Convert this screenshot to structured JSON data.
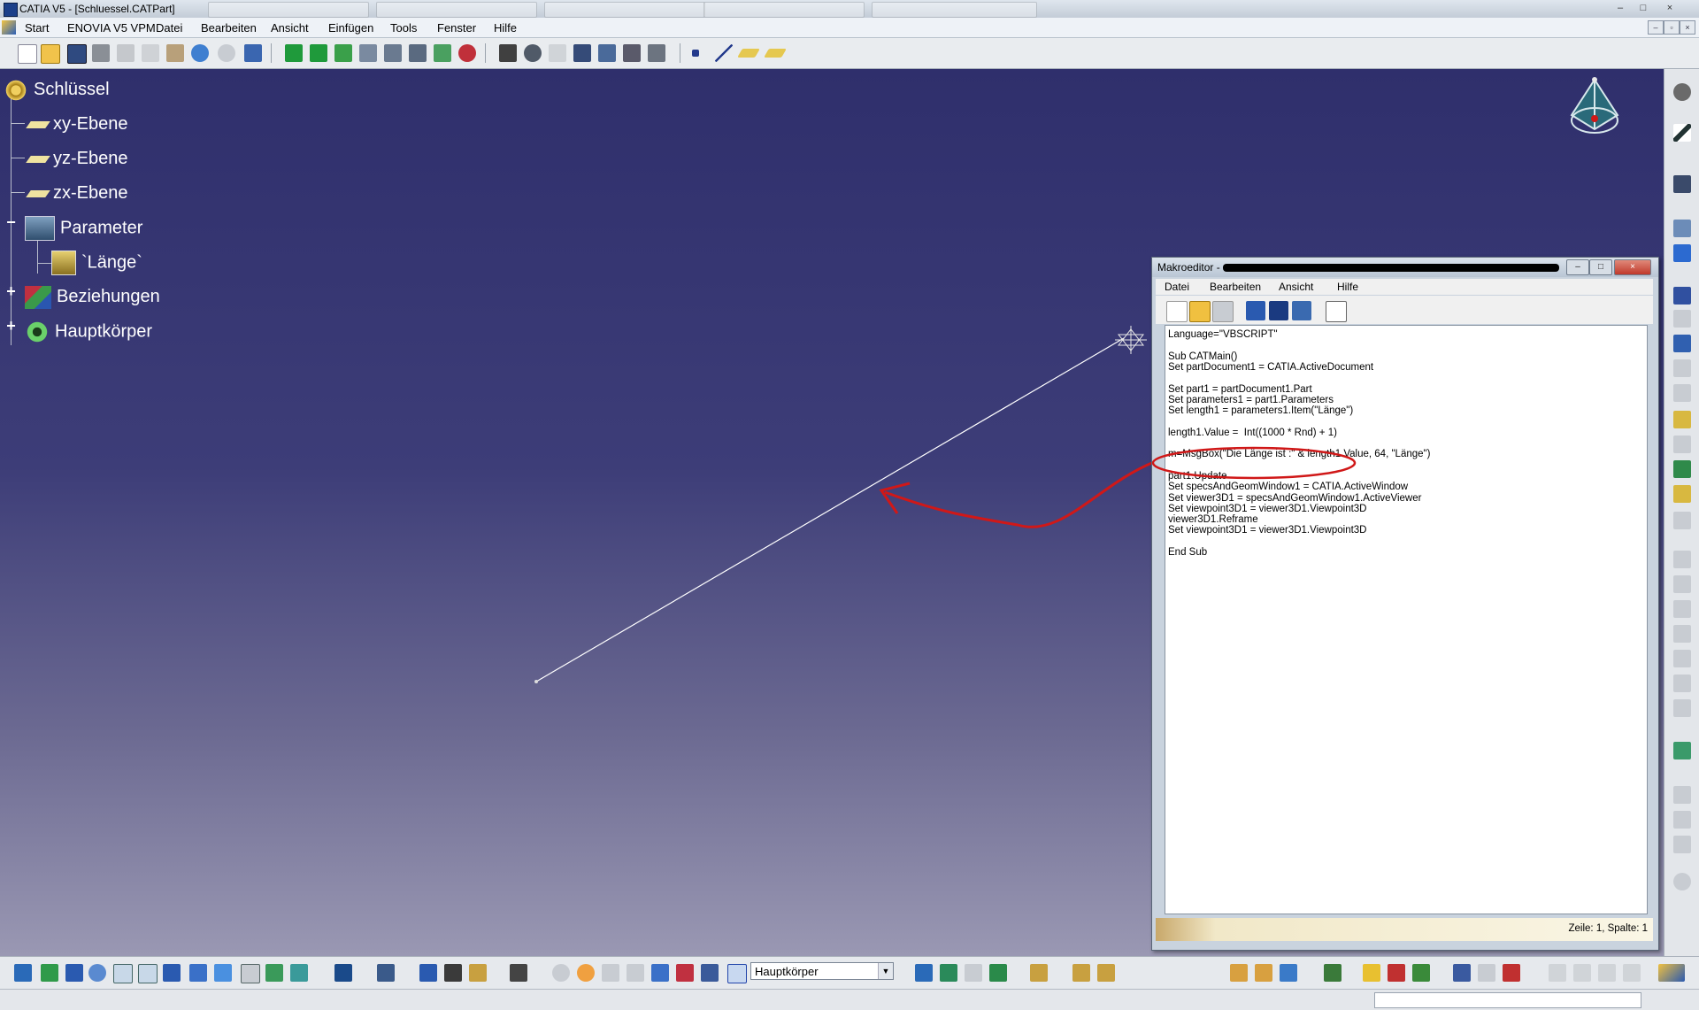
{
  "window": {
    "title": "CATIA V5 - [Schluessel.CATPart]",
    "buttons": [
      "–",
      "□",
      "×"
    ]
  },
  "menubar": {
    "items": [
      "Start",
      "ENOVIA V5 VPM",
      "Datei",
      "Bearbeiten",
      "Ansicht",
      "Einfügen",
      "Tools",
      "Fenster",
      "Hilfe"
    ]
  },
  "tree": {
    "root": "Schlüssel",
    "nodes": [
      "xy-Ebene",
      "yz-Ebene",
      "zx-Ebene",
      "Parameter",
      "`Länge`",
      "Beziehungen",
      "Hauptkörper"
    ]
  },
  "toolbar": {
    "current_body": "Hauptkörper"
  },
  "macro_editor": {
    "title": "Makroeditor -",
    "menu": [
      "Datei",
      "Bearbeiten",
      "Ansicht",
      "Hilfe"
    ],
    "code_lines": [
      "Language=\"VBSCRIPT\"",
      "",
      "Sub CATMain()",
      "Set partDocument1 = CATIA.ActiveDocument",
      "",
      "Set part1 = partDocument1.Part",
      "Set parameters1 = part1.Parameters",
      "Set length1 = parameters1.Item(\"Länge\")",
      "",
      "length1.Value =  Int((1000 * Rnd) + 1)",
      "",
      "m=MsgBox(\"Die Länge ist :\" & length1.Value, 64, \"Länge\")",
      "",
      "part1.Update",
      "Set specsAndGeomWindow1 = CATIA.ActiveWindow",
      "Set viewer3D1 = specsAndGeomWindow1.ActiveViewer",
      "Set viewpoint3D1 = viewer3D1.Viewpoint3D",
      "viewer3D1.Reframe",
      "Set viewpoint3D1 = viewer3D1.Viewpoint3D",
      "",
      "End Sub"
    ],
    "status": "Zeile: 1, Spalte: 1"
  },
  "colors": {
    "annotation": "#d01818",
    "viewport_top": "#2f2f6c",
    "viewport_bottom": "#9a98b3"
  }
}
